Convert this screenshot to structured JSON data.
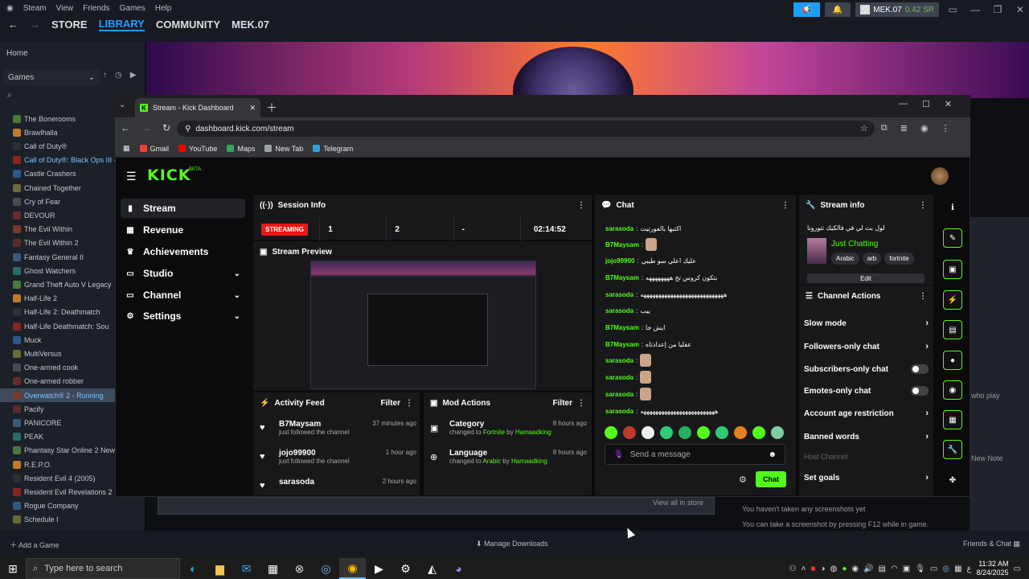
{
  "steam": {
    "menu": [
      "Steam",
      "View",
      "Friends",
      "Games",
      "Help"
    ],
    "nav": {
      "store": "STORE",
      "library": "LIBRARY",
      "community": "COMMUNITY",
      "user": "MEK.07"
    },
    "user": {
      "name": "MEK.07",
      "balance": "0.42 SR"
    },
    "home": "Home",
    "games_filter": "Games",
    "games": [
      {
        "name": "The Bonerooms",
        "state": ""
      },
      {
        "name": "Brawlhalla",
        "state": ""
      },
      {
        "name": "Call of Duty®",
        "state": ""
      },
      {
        "name": "Call of Duty®: Black Ops III -",
        "state": "blue"
      },
      {
        "name": "Castle Crashers",
        "state": ""
      },
      {
        "name": "Chained Together",
        "state": ""
      },
      {
        "name": "Cry of Fear",
        "state": ""
      },
      {
        "name": "DEVOUR",
        "state": ""
      },
      {
        "name": "The Evil Within",
        "state": ""
      },
      {
        "name": "The Evil Within 2",
        "state": ""
      },
      {
        "name": "Fantasy General II",
        "state": ""
      },
      {
        "name": "Ghost Watchers",
        "state": ""
      },
      {
        "name": "Grand Theft Auto V Legacy",
        "state": ""
      },
      {
        "name": "Half-Life 2",
        "state": ""
      },
      {
        "name": "Half-Life 2: Deathmatch",
        "state": ""
      },
      {
        "name": "Half-Life Deathmatch: Sou",
        "state": ""
      },
      {
        "name": "Muck",
        "state": ""
      },
      {
        "name": "MultiVersus",
        "state": ""
      },
      {
        "name": "One-armed cook",
        "state": ""
      },
      {
        "name": "One-armed robber",
        "state": ""
      },
      {
        "name": "Overwatch® 2 - Running",
        "state": "run"
      },
      {
        "name": "Pacify",
        "state": ""
      },
      {
        "name": "PANICORE",
        "state": ""
      },
      {
        "name": "PEAK",
        "state": ""
      },
      {
        "name": "Phantasy Star Online 2 New",
        "state": ""
      },
      {
        "name": "R.E.P.O.",
        "state": ""
      },
      {
        "name": "Resident Evil 4 (2005)",
        "state": ""
      },
      {
        "name": "Resident Evil Revelations 2",
        "state": ""
      },
      {
        "name": "Rogue Company",
        "state": ""
      },
      {
        "name": "Schedule I",
        "state": ""
      }
    ],
    "add_game": "Add a Game",
    "manage_downloads": "Manage Downloads",
    "friends_chat": "Friends & Chat",
    "view_store": "View all in store",
    "screenshots_1": "You haven't taken any screenshots yet",
    "screenshots_2": "You can take a screenshot by pressing F12 while in game.",
    "who_play": "who play",
    "new_note": "New Note"
  },
  "browser": {
    "tab_title": "Stream - Kick Dashboard",
    "url": "dashboard.kick.com/stream",
    "bookmarks": [
      {
        "label": "Gmail",
        "color": "#ea4335"
      },
      {
        "label": "YouTube",
        "color": "#ff0000"
      },
      {
        "label": "Maps",
        "color": "#34a853"
      },
      {
        "label": "New Tab",
        "color": "#9aa0a6"
      },
      {
        "label": "Telegram",
        "color": "#2aa3e0"
      }
    ]
  },
  "kick": {
    "logo": "KICK",
    "beta": "BETA",
    "nav": [
      {
        "label": "Stream",
        "icon": "▮"
      },
      {
        "label": "Revenue",
        "icon": "▦"
      },
      {
        "label": "Achievements",
        "icon": "♛"
      },
      {
        "label": "Studio",
        "icon": "▭"
      },
      {
        "label": "Channel",
        "icon": "▭"
      },
      {
        "label": "Settings",
        "icon": "⚙"
      }
    ],
    "session": {
      "title": "Session Info",
      "status": "STREAMING",
      "stat1": "1",
      "stat2": "2",
      "stat3": "-",
      "duration": "02:14:52"
    },
    "preview_title": "Stream Preview",
    "activity": {
      "title": "Activity Feed",
      "filter": "Filter",
      "items": [
        {
          "user": "B7Maysam",
          "text": "just followed the channel",
          "ago": "37 minutes ago"
        },
        {
          "user": "jojo99900",
          "text": "just followed the channel",
          "ago": "1 hour ago"
        },
        {
          "user": "sarasoda",
          "text": "",
          "ago": "2 hours ago"
        }
      ]
    },
    "mod": {
      "title": "Mod Actions",
      "filter": "Filter",
      "items": [
        {
          "label": "Category",
          "pre": "changed to ",
          "value": "Fortnite",
          "mid": " by ",
          "by": "Hamaadking",
          "ago": "8 hours ago"
        },
        {
          "label": "Language",
          "pre": "changed to ",
          "value": "Arabic",
          "mid": " by ",
          "by": "Hamaadking",
          "ago": "8 hours ago"
        }
      ]
    },
    "chat": {
      "title": "Chat",
      "messages": [
        {
          "user": "sarasoda",
          "color": "#53fc18",
          "text": "اكتبها بالفورتيت",
          "emote": false
        },
        {
          "user": "B7Maysam",
          "color": "#53fc18",
          "text": "",
          "emote": true
        },
        {
          "user": "jojo99900",
          "color": "#53fc18",
          "text": "عليك اعلي سو طيبي",
          "emote": false
        },
        {
          "user": "B7Maysam",
          "color": "#53fc18",
          "text": "بتكون كروس تخ ههههههههه",
          "emote": false
        },
        {
          "user": "sarasoda",
          "color": "#53fc18",
          "text": "ههههههههههههههههههههههههههههه",
          "emote": false
        },
        {
          "user": "sarasoda",
          "color": "#53fc18",
          "text": "ييب",
          "emote": false
        },
        {
          "user": "B7Maysam",
          "color": "#53fc18",
          "text": "ايش جا",
          "emote": false
        },
        {
          "user": "B7Maysam",
          "color": "#53fc18",
          "text": "عقليا من إعدادتاه",
          "emote": false
        },
        {
          "user": "sarasoda",
          "color": "#53fc18",
          "text": "",
          "emote": true
        },
        {
          "user": "sarasoda",
          "color": "#53fc18",
          "text": "",
          "emote": true
        },
        {
          "user": "sarasoda",
          "color": "#53fc18",
          "text": "",
          "emote": true
        },
        {
          "user": "sarasoda",
          "color": "#53fc18",
          "text": "هههههههههههههههههههههههههه",
          "emote": false
        }
      ],
      "placeholder": "Send a message",
      "send": "Chat"
    },
    "stream_info": {
      "title": "Stream info",
      "stream_title": "لول بث لي في فالكيك تتورونا",
      "category": "Just Chatting",
      "tags": [
        "Arabic",
        "arb",
        "fortnite"
      ],
      "edit": "Edit"
    },
    "channel_actions": {
      "title": "Channel Actions",
      "rows": [
        {
          "label": "Slow mode",
          "type": "arrow"
        },
        {
          "label": "Followers-only chat",
          "type": "arrow"
        },
        {
          "label": "Subscribers-only chat",
          "type": "toggle"
        },
        {
          "label": "Emotes-only chat",
          "type": "toggle"
        },
        {
          "label": "Account age restriction",
          "type": "arrow"
        },
        {
          "label": "Banned words",
          "type": "arrow"
        },
        {
          "label": "Host Channel",
          "type": "dim"
        },
        {
          "label": "Set goals",
          "type": "arrow"
        }
      ]
    }
  },
  "taskbar": {
    "search": "Type here to search",
    "time": "11:32 AM",
    "date": "8/24/2025"
  },
  "colors": {
    "kick_green": "#53fc18",
    "steam_blue": "#1a9fff"
  }
}
